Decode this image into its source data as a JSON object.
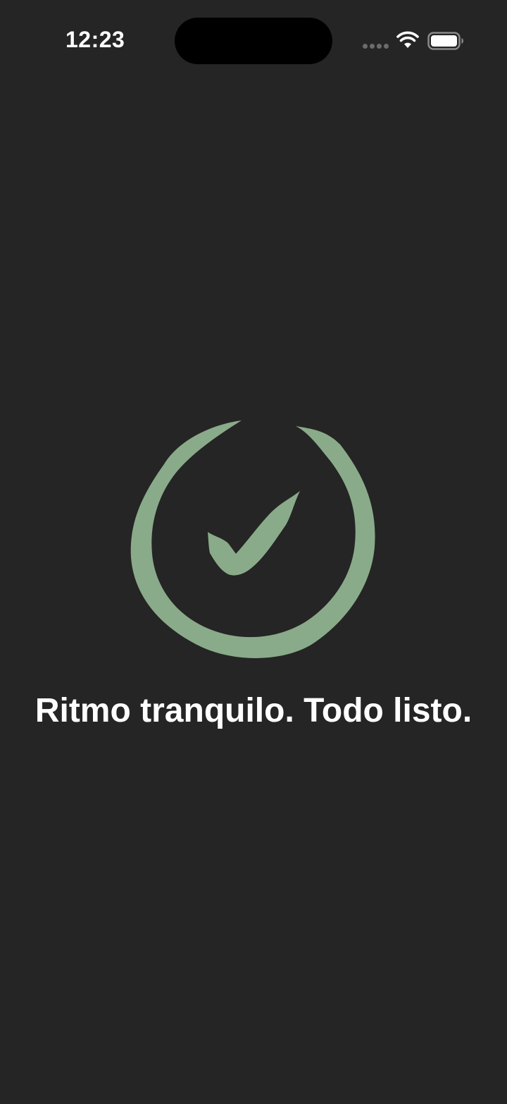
{
  "status_bar": {
    "time": "12:23",
    "icons": [
      "cellular-signal-icon",
      "wifi-icon",
      "battery-icon"
    ]
  },
  "main": {
    "message": "Ritmo tranquilo. Todo listo.",
    "graphic_icon": "checkmark-circle-icon",
    "accent_color": "#8aab8a"
  },
  "colors": {
    "background": "#252525",
    "text": "#ffffff",
    "accent": "#8aab8a"
  }
}
